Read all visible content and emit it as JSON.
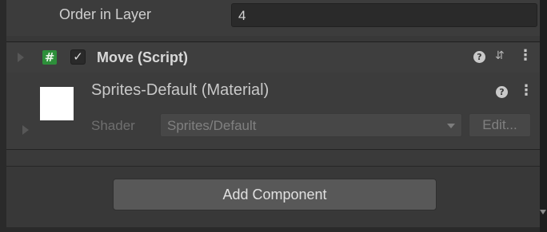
{
  "order_in_layer": {
    "label": "Order in Layer",
    "value": "4"
  },
  "script_component": {
    "icon": "csharp-script-icon",
    "enabled": true,
    "checkmark": "✓",
    "title": "Move (Script)",
    "help_glyph": "?",
    "presets_glyph": "⇵",
    "menu_glyph": "⋮"
  },
  "material": {
    "thumbnail_color": "#ffffff",
    "title": "Sprites-Default (Material)",
    "help_glyph": "?",
    "menu_glyph": "⋮",
    "shader_label": "Shader",
    "shader_value": "Sprites/Default",
    "edit_label": "Edit..."
  },
  "add_component": {
    "label": "Add Component"
  },
  "colors": {
    "script_icon_green": "#2d8f3a",
    "panel_bg": "#383838",
    "button_bg": "#585858"
  }
}
